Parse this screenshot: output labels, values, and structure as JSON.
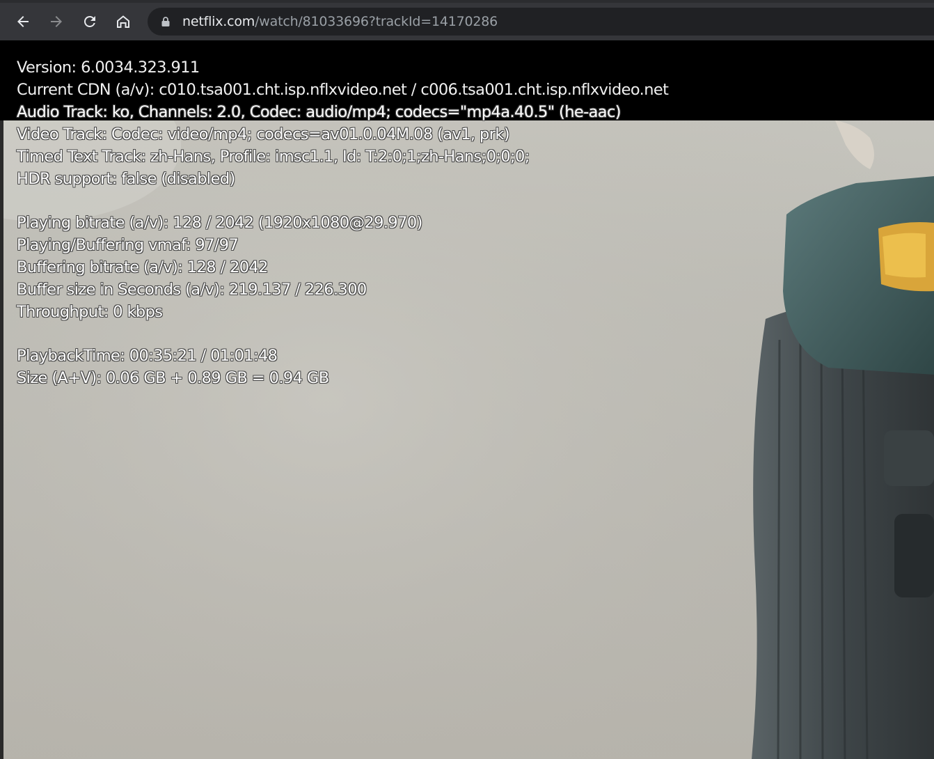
{
  "browser": {
    "nav": {
      "back_icon": "arrow-left-icon",
      "forward_icon": "arrow-right-icon",
      "reload_icon": "reload-icon",
      "home_icon": "home-icon"
    },
    "address_bar": {
      "secure_icon": "lock-icon",
      "host": "netflix.com",
      "path": "/watch/81033696?trackId=14170286"
    }
  },
  "player_stats": {
    "version": "Version: 6.0034.323.911",
    "cdn": "Current CDN (a/v): c010.tsa001.cht.isp.nflxvideo.net / c006.tsa001.cht.isp.nflxvideo.net",
    "audio_track": "Audio Track: ko, Channels: 2.0, Codec: audio/mp4; codecs=\"mp4a.40.5\" (he-aac)",
    "video_track": "Video Track: Codec: video/mp4; codecs=av01.0.04M.08 (av1, prk)",
    "timed_text_track": "Timed Text Track: zh-Hans, Profile: imsc1.1, Id: T:2:0;1;zh-Hans;0;0;0;",
    "hdr_support": "HDR support: false (disabled)",
    "playing_bitrate": "Playing bitrate (a/v): 128 / 2042 (1920x1080@29.970)",
    "vmaf": "Playing/Buffering vmaf: 97/97",
    "buffering_bitrate": "Buffering bitrate (a/v): 128 / 2042",
    "buffer_size": "Buffer size in Seconds (a/v): 219.137 / 226.300",
    "throughput": "Throughput: 0 kbps",
    "playback_time": "PlaybackTime: 00:35:21 / 01:01:48",
    "size": "Size (A+V): 0.06 GB + 0.89 GB = 0.94 GB"
  },
  "colors": {
    "toolbar_bg": "#35363a",
    "omnibox_bg": "#202124",
    "url_host": "#e8eaed",
    "url_path": "#9aa0a6",
    "stats_text": "#ffffff"
  }
}
